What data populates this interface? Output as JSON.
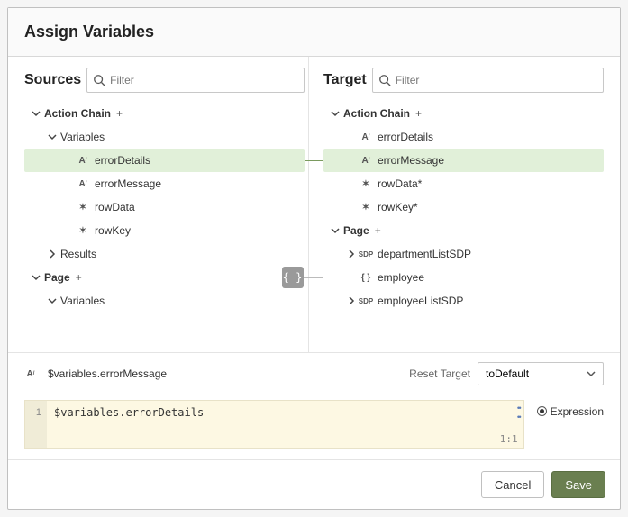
{
  "header": {
    "title": "Assign Variables"
  },
  "sources": {
    "title": "Sources",
    "filterPlaceholder": "Filter",
    "tree": [
      {
        "label": "Action Chain",
        "children": [
          {
            "label": "Variables",
            "children": [
              {
                "label": "errorDetails",
                "type": "string",
                "selected": true
              },
              {
                "label": "errorMessage",
                "type": "string"
              },
              {
                "label": "rowData",
                "type": "any"
              },
              {
                "label": "rowKey",
                "type": "any"
              }
            ]
          },
          {
            "label": "Results",
            "expanded": false
          }
        ]
      },
      {
        "label": "Page",
        "children": [
          {
            "label": "Variables",
            "expanded": true
          }
        ]
      }
    ]
  },
  "target": {
    "title": "Target",
    "filterPlaceholder": "Filter",
    "tree": [
      {
        "label": "Action Chain",
        "children": [
          {
            "label": "errorDetails",
            "type": "string"
          },
          {
            "label": "errorMessage",
            "type": "string",
            "selected": true
          },
          {
            "label": "rowData*",
            "type": "any"
          },
          {
            "label": "rowKey*",
            "type": "any"
          }
        ]
      },
      {
        "label": "Page",
        "children": [
          {
            "label": "departmentListSDP",
            "type": "sdp"
          },
          {
            "label": "employee",
            "type": "object"
          },
          {
            "label": "employeeListSDP",
            "type": "sdp"
          }
        ]
      }
    ]
  },
  "footer": {
    "variablePath": "$variables.errorMessage",
    "resetLabel": "Reset Target",
    "resetValue": "toDefault"
  },
  "editor": {
    "lineNumber": "1",
    "code": "$variables.errorDetails",
    "cursorPos": "1:1",
    "modeLabel": "Expression"
  },
  "actions": {
    "cancel": "Cancel",
    "save": "Save"
  },
  "colors": {
    "selectedRow": "#e1f0d9",
    "primaryButton": "#6a7f50",
    "connector": "#7a9a5e",
    "editorBg": "#fdf8e3"
  }
}
